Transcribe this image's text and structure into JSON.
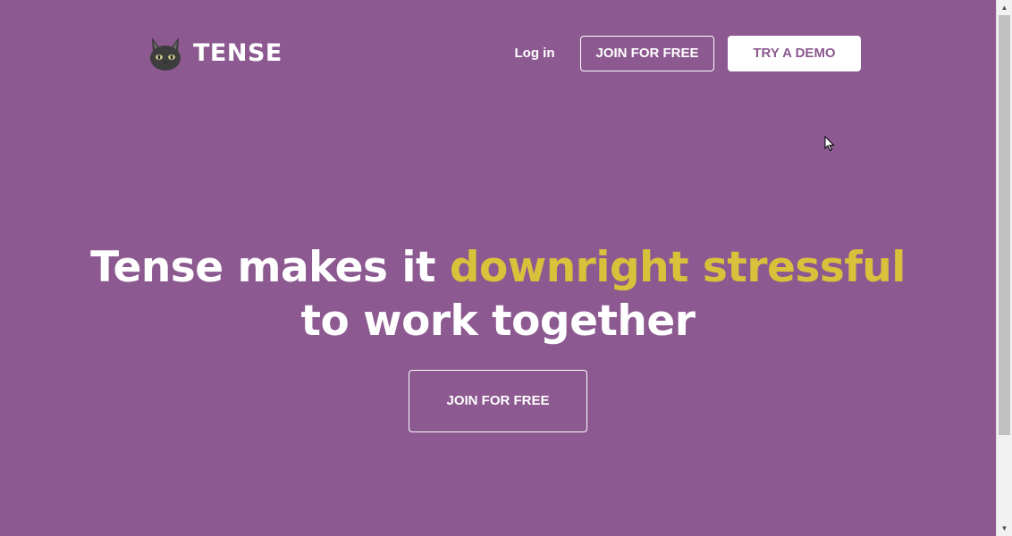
{
  "header": {
    "brand_name": "TENSE",
    "logo_icon": "cat-icon",
    "login_label": "Log in",
    "join_label": "JOIN FOR FREE",
    "demo_label": "TRY A DEMO"
  },
  "hero": {
    "title_part1": "Tense makes it ",
    "title_accent": "downright stressful",
    "title_part2": "to work together",
    "cta_label": "JOIN FOR FREE"
  },
  "colors": {
    "background": "#8c5990",
    "accent": "#d8c23b",
    "text": "#ffffff"
  }
}
